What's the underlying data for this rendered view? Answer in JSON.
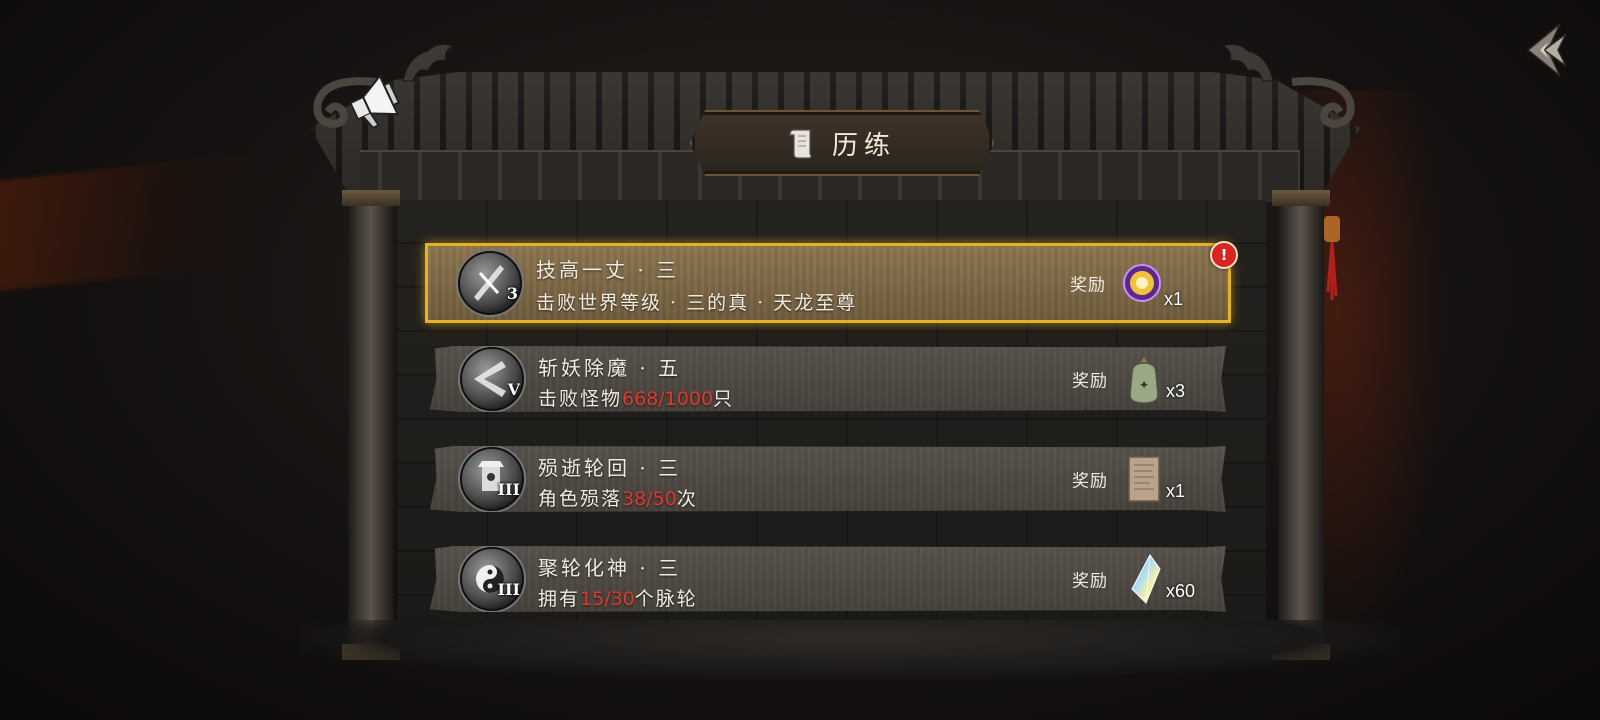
{
  "header": {
    "title": "历练",
    "back_icon": "diamond-back-icon"
  },
  "quests": [
    {
      "title": "技高一丈 · 三",
      "desc_prefix": "击败世界等级 · 三的真 · 天龙至尊",
      "progress": "",
      "desc_suffix": "",
      "reward_label": "奖励",
      "reward_count": "x1",
      "icon_numeral": "3",
      "reward_icon": "golden-orb-icon",
      "alert": "!",
      "status": "highlighted"
    },
    {
      "title": "斩妖除魔 · 五",
      "desc_prefix": "击败怪物",
      "progress": "668/1000",
      "desc_suffix": "只",
      "reward_label": "奖励",
      "reward_count": "x3",
      "icon_numeral": "V",
      "reward_icon": "jade-pouch-icon"
    },
    {
      "title": "殒逝轮回 · 三",
      "desc_prefix": "角色殒落",
      "progress": "38/50",
      "desc_suffix": "次",
      "reward_label": "奖励",
      "reward_count": "x1",
      "icon_numeral": "III",
      "reward_icon": "scroll-page-icon"
    },
    {
      "title": "聚轮化神 · 三",
      "desc_prefix": "拥有",
      "progress": "15/30",
      "desc_suffix": "个脉轮",
      "reward_label": "奖励",
      "reward_count": "x60",
      "icon_numeral": "III",
      "reward_icon": "rainbow-crystal-icon"
    }
  ],
  "colors": {
    "progress_red": "#e0382f",
    "highlight_gold": "#e3b12a",
    "card_grey": "#4f4a44",
    "card_gold": "#7c6847"
  }
}
